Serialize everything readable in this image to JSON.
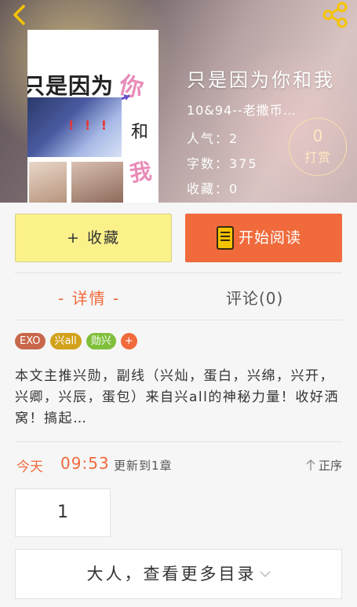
{
  "header": {
    "back_icon": "back-arrow-icon",
    "share_icon": "share-icon",
    "accent": "#f5c400"
  },
  "cover": {
    "title_text": "只是因为",
    "ni": "你",
    "he": "和",
    "wo": "我",
    "marks": "! ! !"
  },
  "book": {
    "title": "只是因为你和我",
    "author": "10&94--老撒币…",
    "popularity": "人气：2",
    "word_count": "字数：375",
    "favorites": "收藏：0"
  },
  "tip": {
    "count": "0",
    "label": "打赏"
  },
  "actions": {
    "favorite_label": "+ 收藏",
    "read_label": "开始阅读",
    "favorite_color": "#fbf18a",
    "read_color": "#f06a3c"
  },
  "tabs": {
    "detail": "- 详情 -",
    "comments": "评论(0)"
  },
  "tags": [
    {
      "label": "EXO",
      "color": "#c8674a"
    },
    {
      "label": "兴all",
      "color": "#d2a21c"
    },
    {
      "label": "勋兴",
      "color": "#7fbf3a"
    },
    {
      "label": "+",
      "color": "#f06a3c"
    }
  ],
  "description": "本文主推兴勋，副线（兴灿，蛋白，兴绵，兴开，兴卿，兴辰，蛋包）来自兴all的神秘力量！收好洒窝！搞起…",
  "update": {
    "today": "今天",
    "time": "09:53",
    "text": "更新到1章",
    "sort_label": "正序"
  },
  "pagination": {
    "page": "1"
  },
  "more_catalog": "大人，查看更多目录"
}
